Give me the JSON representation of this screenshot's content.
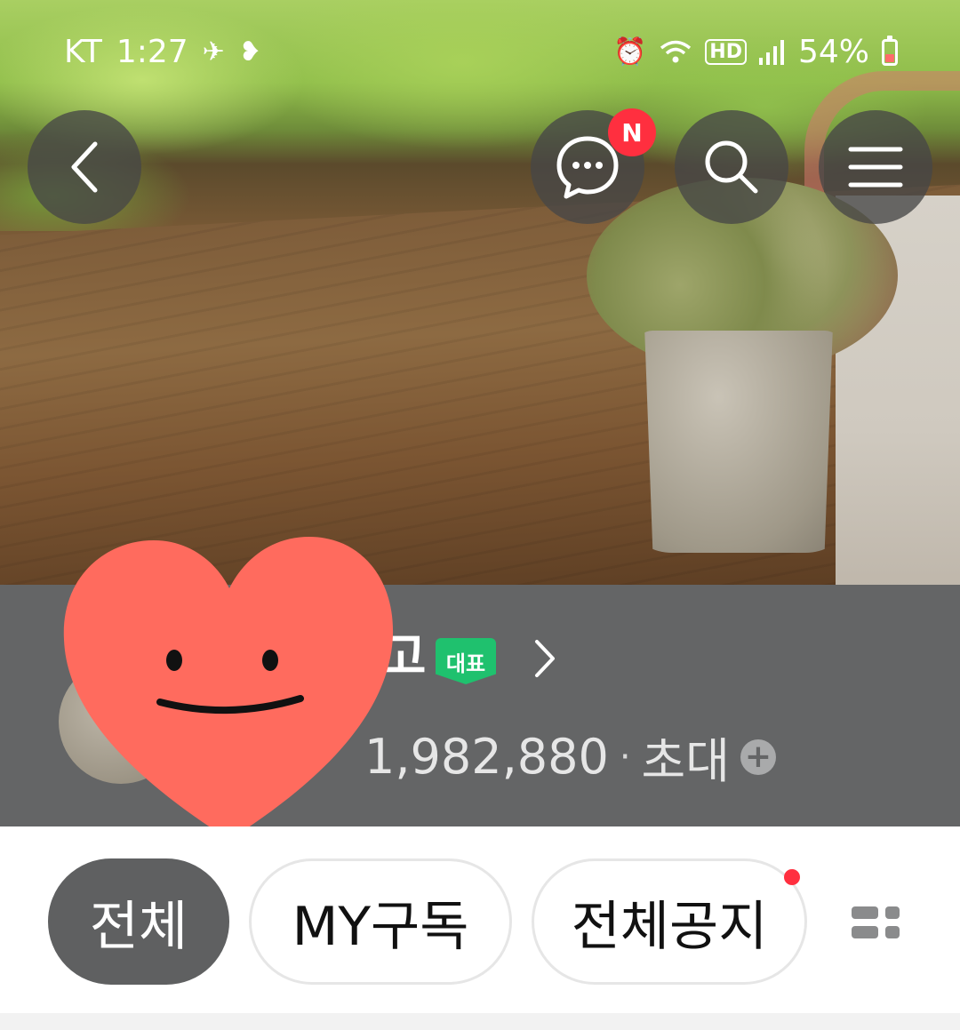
{
  "status_bar": {
    "carrier": "KT",
    "time": "1:27",
    "hd_label": "HD",
    "battery": "54%"
  },
  "header": {
    "message_badge": "N"
  },
  "profile": {
    "name_visible": "고",
    "rep_badge": "대표",
    "member_count": "1,982,880",
    "separator": "·",
    "invite_label": "초대",
    "invite_plus": "+"
  },
  "tabs": [
    {
      "label": "전체",
      "active": true
    },
    {
      "label": "MY구독",
      "active": false
    },
    {
      "label": "전체공지",
      "active": false,
      "has_dot": true
    }
  ],
  "colors": {
    "band": "#646566",
    "active_chip": "#5f6061",
    "badge_red": "#ff2f3f",
    "rep_green": "#1fc16e",
    "heart": "#ff6b5e"
  }
}
